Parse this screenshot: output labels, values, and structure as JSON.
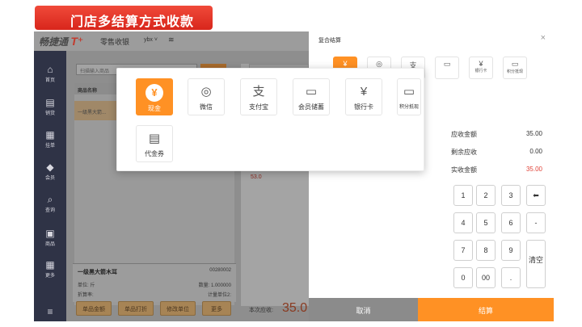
{
  "banner": {
    "title": "门店多结算方式收款"
  },
  "topbar": {
    "logo_text": "畅捷通",
    "logo_mark": "T⁺",
    "mode": "零售收银",
    "user": "ybx ˅"
  },
  "sidebar": {
    "items": [
      {
        "icon": "home-icon",
        "glyph": "⌂",
        "label": "首页"
      },
      {
        "icon": "document-icon",
        "glyph": "▤",
        "label": "销货"
      },
      {
        "icon": "report-icon",
        "glyph": "▦",
        "label": "挂单"
      },
      {
        "icon": "diamond-icon",
        "glyph": "◆",
        "label": "会员"
      },
      {
        "icon": "search-icon",
        "glyph": "⌕",
        "label": "查询"
      },
      {
        "icon": "bag-icon",
        "glyph": "▣",
        "label": "商品"
      },
      {
        "icon": "grid-icon",
        "glyph": "▦",
        "label": "更多"
      },
      {
        "icon": "menu-icon",
        "glyph": "≡",
        "label": ""
      }
    ]
  },
  "products": {
    "search_placeholder": "扫描输入商品",
    "head": "商品名称",
    "selected_item": "一级黑大箭...",
    "price_tag": "53.0"
  },
  "detail": {
    "name": "一级黑大箭木耳",
    "code": "00280002",
    "unit": "单位: 斤",
    "qty": "数量: 1.000000",
    "price": "折算率:",
    "unit_qty": "计量单位2:"
  },
  "bottom_buttons": [
    "单品金额",
    "单品打折",
    "修改单位",
    "更多"
  ],
  "due": {
    "label": "本次应收:",
    "value": "35.0"
  },
  "composite": {
    "title": "复合结算",
    "close": "×",
    "mini_methods": [
      {
        "icon": "yuan-icon",
        "glyph": "¥",
        "label": ""
      },
      {
        "icon": "wechat-icon",
        "glyph": "◎",
        "label": ""
      },
      {
        "icon": "alipay-icon",
        "glyph": "支",
        "label": ""
      },
      {
        "icon": "card-icon",
        "glyph": "▭",
        "label": ""
      },
      {
        "icon": "bankcard-icon",
        "glyph": "¥",
        "label": "银行卡"
      },
      {
        "icon": "points-icon",
        "glyph": "▭",
        "label": "积分抵现"
      }
    ],
    "summary": [
      {
        "label": "应收金额",
        "value": "35.00",
        "red": false
      },
      {
        "label": "剩余应收",
        "value": "0.00",
        "red": false
      },
      {
        "label": "实收金额",
        "value": "35.00",
        "red": true
      }
    ],
    "keys": [
      "1",
      "2",
      "3",
      "⬅",
      "4",
      "5",
      "6",
      "-",
      "7",
      "8",
      "9",
      "清空",
      "0",
      "00",
      "."
    ],
    "cancel": "取消",
    "settle": "结算"
  },
  "popup": {
    "methods": [
      {
        "icon": "yuan-icon",
        "glyph": "¥",
        "label": "现金",
        "active": true
      },
      {
        "icon": "wechat-icon",
        "glyph": "◎",
        "label": "微信",
        "active": false
      },
      {
        "icon": "alipay-icon",
        "glyph": "支",
        "label": "支付宝",
        "active": false
      },
      {
        "icon": "member-card-icon",
        "glyph": "▭",
        "label": "会员储蓄",
        "active": false
      },
      {
        "icon": "bankcard-icon",
        "glyph": "¥",
        "label": "银行卡",
        "active": false
      },
      {
        "icon": "points-icon",
        "glyph": "▭",
        "label": "积分抵现",
        "active": false
      },
      {
        "icon": "voucher-icon",
        "glyph": "▤",
        "label": "代金券",
        "active": false
      }
    ]
  }
}
